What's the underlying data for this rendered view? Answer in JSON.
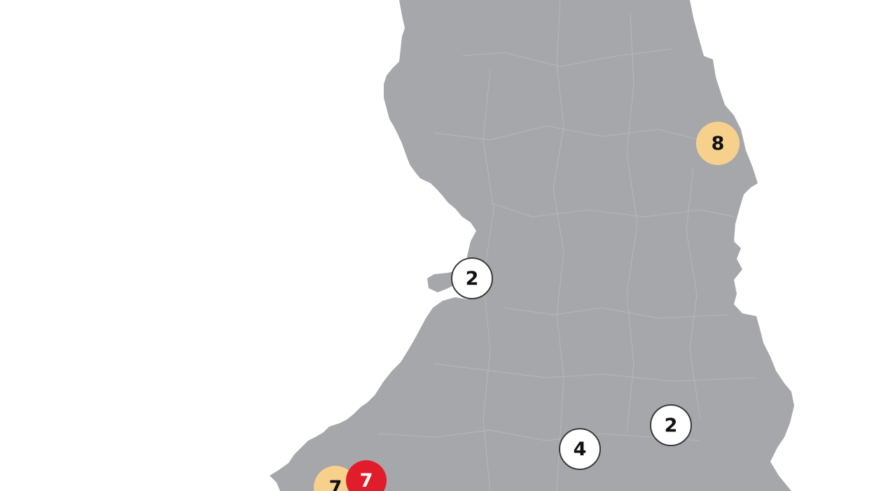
{
  "map": {
    "land_color": "#a6a7aa",
    "border_color": "#b5b6b9",
    "water_color": "#ffffff"
  },
  "markers": [
    {
      "id": "north-east",
      "value": "8",
      "style": "yellow"
    },
    {
      "id": "west-coast",
      "value": "2",
      "style": "white"
    },
    {
      "id": "east",
      "value": "2",
      "style": "white"
    },
    {
      "id": "central-south",
      "value": "4",
      "style": "white"
    },
    {
      "id": "south-west-a",
      "value": "7",
      "style": "yellow"
    },
    {
      "id": "south-west-b",
      "value": "7",
      "style": "red"
    }
  ],
  "colors": {
    "yellow": "#f7d18c",
    "red": "#e11d2c",
    "white": "#ffffff"
  }
}
